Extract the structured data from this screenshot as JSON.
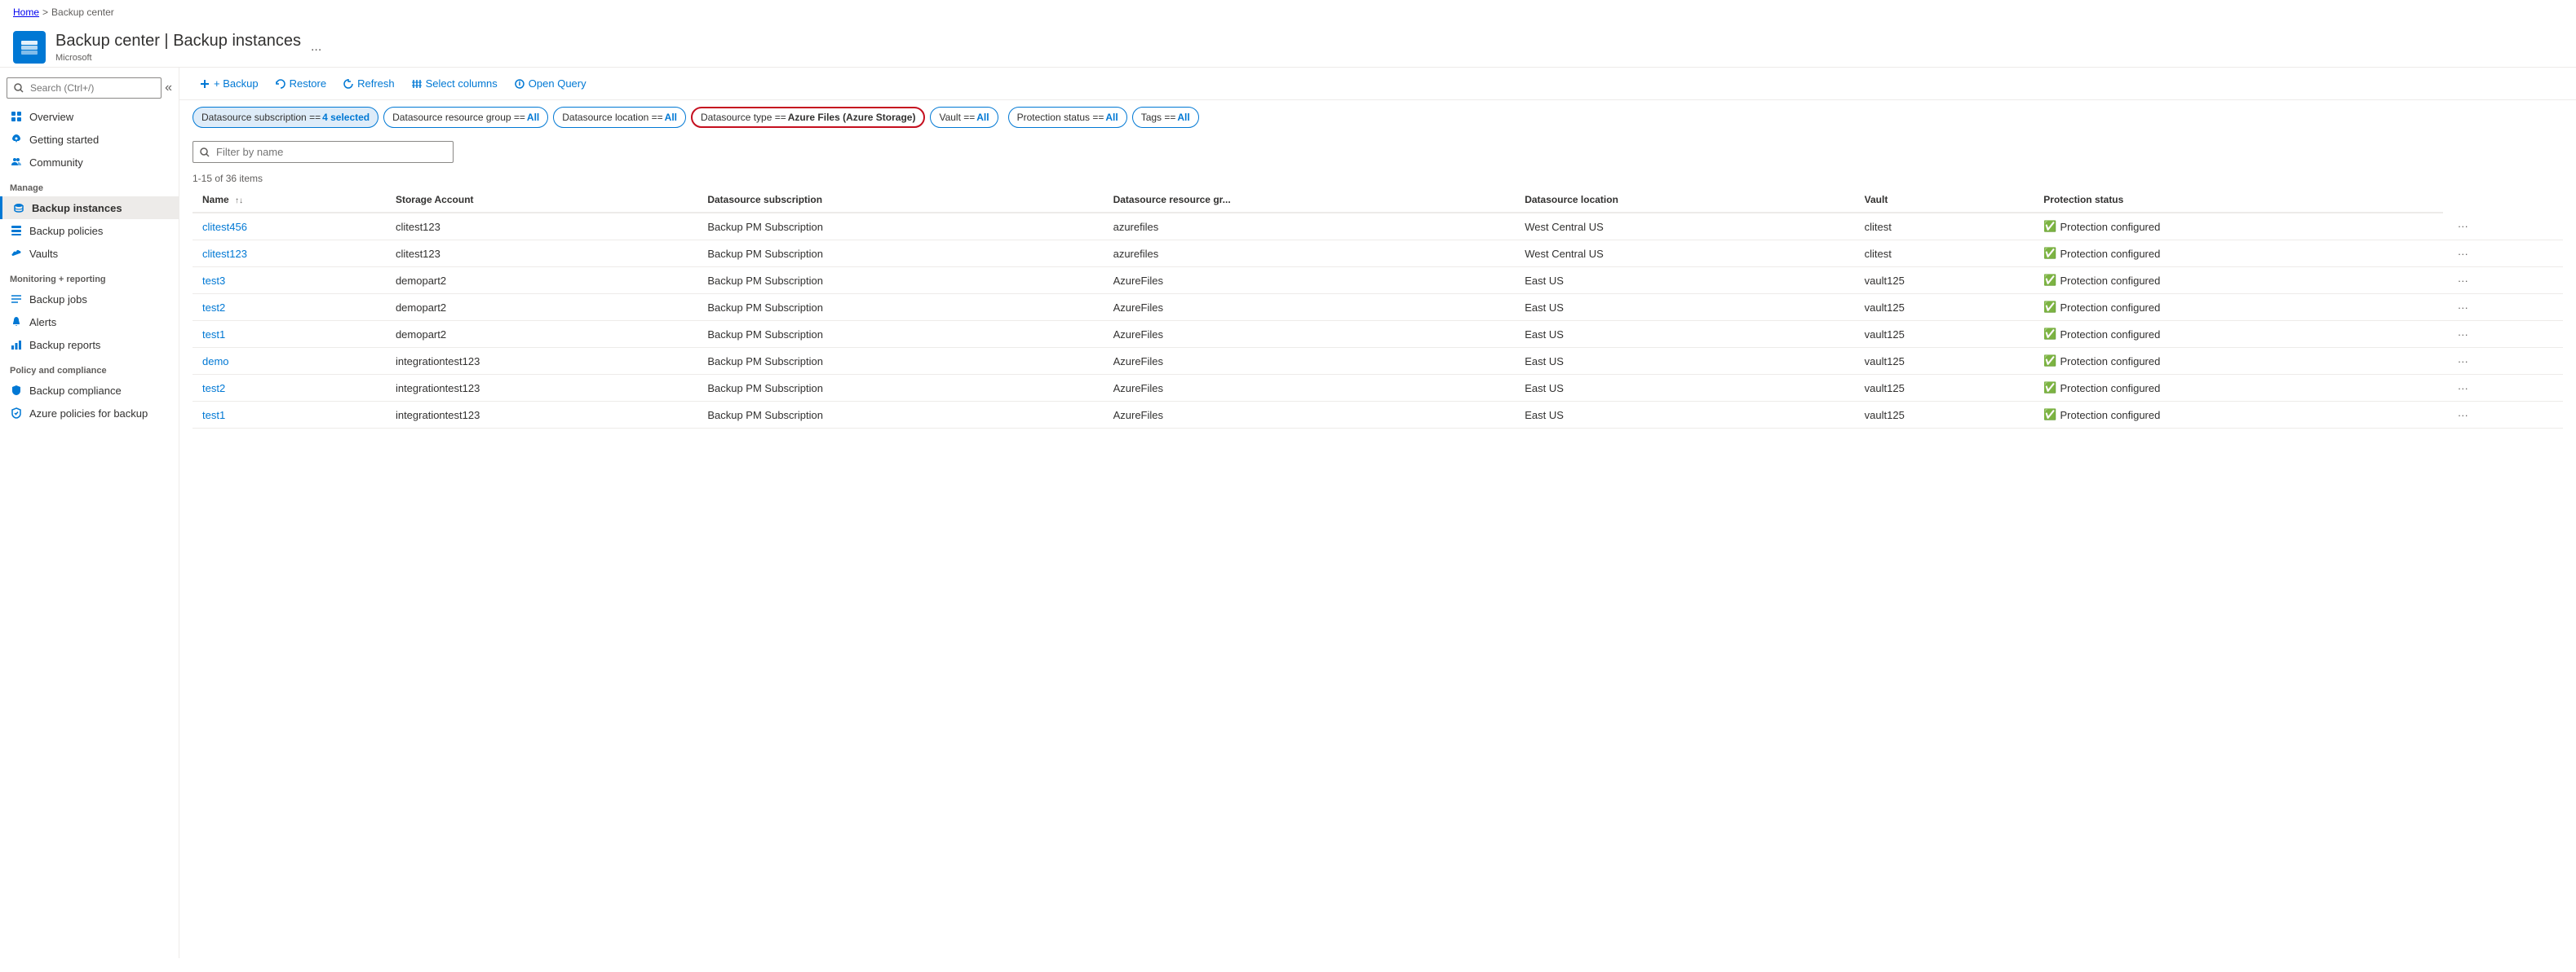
{
  "breadcrumb": {
    "home": "Home",
    "separator": ">",
    "current": "Backup center"
  },
  "header": {
    "title": "Backup center",
    "separator": "|",
    "subtitle": "Backup instances",
    "vendor": "Microsoft",
    "more": "..."
  },
  "sidebar": {
    "search_placeholder": "Search (Ctrl+/)",
    "collapse_icon": "«",
    "items_top": [
      {
        "id": "overview",
        "label": "Overview",
        "icon": "grid"
      },
      {
        "id": "getting-started",
        "label": "Getting started",
        "icon": "rocket"
      },
      {
        "id": "community",
        "label": "Community",
        "icon": "people"
      }
    ],
    "section_manage": "Manage",
    "items_manage": [
      {
        "id": "backup-instances",
        "label": "Backup instances",
        "icon": "database",
        "active": true
      },
      {
        "id": "backup-policies",
        "label": "Backup policies",
        "icon": "grid2"
      },
      {
        "id": "vaults",
        "label": "Vaults",
        "icon": "cloud"
      }
    ],
    "section_monitoring": "Monitoring + reporting",
    "items_monitoring": [
      {
        "id": "backup-jobs",
        "label": "Backup jobs",
        "icon": "list"
      },
      {
        "id": "alerts",
        "label": "Alerts",
        "icon": "bell"
      },
      {
        "id": "backup-reports",
        "label": "Backup reports",
        "icon": "chart"
      }
    ],
    "section_policy": "Policy and compliance",
    "items_policy": [
      {
        "id": "backup-compliance",
        "label": "Backup compliance",
        "icon": "shield"
      },
      {
        "id": "azure-policies",
        "label": "Azure policies for backup",
        "icon": "check-shield"
      }
    ]
  },
  "toolbar": {
    "backup_label": "+ Backup",
    "restore_label": "Restore",
    "refresh_label": "Refresh",
    "select_columns_label": "Select columns",
    "open_query_label": "Open Query"
  },
  "filters": [
    {
      "id": "subscription",
      "key": "Datasource subscription ==",
      "value": "4 selected",
      "style": "active-blue"
    },
    {
      "id": "resource-group",
      "key": "Datasource resource group ==",
      "value": "All",
      "style": "normal"
    },
    {
      "id": "location",
      "key": "Datasource location ==",
      "value": "All",
      "style": "normal"
    },
    {
      "id": "type",
      "key": "Datasource type ==",
      "value": "Azure Files (Azure Storage)",
      "style": "highlighted"
    },
    {
      "id": "vault",
      "key": "Vault ==",
      "value": "All",
      "style": "normal"
    },
    {
      "id": "protection-status",
      "key": "Protection status ==",
      "value": "All",
      "style": "normal"
    },
    {
      "id": "tags",
      "key": "Tags ==",
      "value": "All",
      "style": "normal"
    }
  ],
  "search": {
    "placeholder": "Filter by name"
  },
  "item_count": "1-15 of 36 items",
  "table": {
    "columns": [
      {
        "id": "name",
        "label": "Name",
        "sortable": true
      },
      {
        "id": "storage-account",
        "label": "Storage Account"
      },
      {
        "id": "subscription",
        "label": "Datasource subscription"
      },
      {
        "id": "resource-group",
        "label": "Datasource resource gr..."
      },
      {
        "id": "location",
        "label": "Datasource location"
      },
      {
        "id": "vault",
        "label": "Vault"
      },
      {
        "id": "protection-status",
        "label": "Protection status"
      }
    ],
    "rows": [
      {
        "name": "clitest456",
        "storage": "clitest123",
        "subscription": "Backup PM Subscription",
        "rg": "azurefiles",
        "location": "West Central US",
        "vault": "clitest",
        "status": "Protection configured"
      },
      {
        "name": "clitest123",
        "storage": "clitest123",
        "subscription": "Backup PM Subscription",
        "rg": "azurefiles",
        "location": "West Central US",
        "vault": "clitest",
        "status": "Protection configured"
      },
      {
        "name": "test3",
        "storage": "demopart2",
        "subscription": "Backup PM Subscription",
        "rg": "AzureFiles",
        "location": "East US",
        "vault": "vault125",
        "status": "Protection configured"
      },
      {
        "name": "test2",
        "storage": "demopart2",
        "subscription": "Backup PM Subscription",
        "rg": "AzureFiles",
        "location": "East US",
        "vault": "vault125",
        "status": "Protection configured"
      },
      {
        "name": "test1",
        "storage": "demopart2",
        "subscription": "Backup PM Subscription",
        "rg": "AzureFiles",
        "location": "East US",
        "vault": "vault125",
        "status": "Protection configured"
      },
      {
        "name": "demo",
        "storage": "integrationtest123",
        "subscription": "Backup PM Subscription",
        "rg": "AzureFiles",
        "location": "East US",
        "vault": "vault125",
        "status": "Protection configured"
      },
      {
        "name": "test2",
        "storage": "integrationtest123",
        "subscription": "Backup PM Subscription",
        "rg": "AzureFiles",
        "location": "East US",
        "vault": "vault125",
        "status": "Protection configured"
      },
      {
        "name": "test1",
        "storage": "integrationtest123",
        "subscription": "Backup PM Subscription",
        "rg": "AzureFiles",
        "location": "East US",
        "vault": "vault125",
        "status": "Protection configured"
      }
    ]
  },
  "colors": {
    "accent": "#0078d4",
    "success": "#107c10",
    "border_highlight": "#c50f1f",
    "filter_active_bg": "#deecf9"
  }
}
